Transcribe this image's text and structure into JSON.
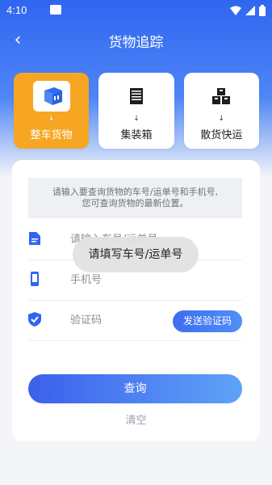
{
  "status_bar": {
    "time": "4:10"
  },
  "nav": {
    "back_glyph": "‹",
    "title": "货物追踪"
  },
  "tabs": [
    {
      "label": "整车货物",
      "icon": "truck-box-icon",
      "active": true
    },
    {
      "label": "集装箱",
      "icon": "container-icon",
      "active": false
    },
    {
      "label": "散货快运",
      "icon": "boxes-icon",
      "active": false
    }
  ],
  "tab_arrow": "↓",
  "form": {
    "hint_line1": "请输入要查询货物的车号/运单号和手机号,",
    "hint_line2": "您可查询货物的最新位置。",
    "waybill_placeholder": "请输入车号/运单号",
    "phone_placeholder": "手机号",
    "code_placeholder": "验证码",
    "send_code_label": "发送验证码",
    "query_label": "查询",
    "clear_label": "清空"
  },
  "toast": {
    "message": "请填写车号/运单号"
  },
  "colors": {
    "primary": "#3b6cf0",
    "accent": "#f6a623"
  }
}
